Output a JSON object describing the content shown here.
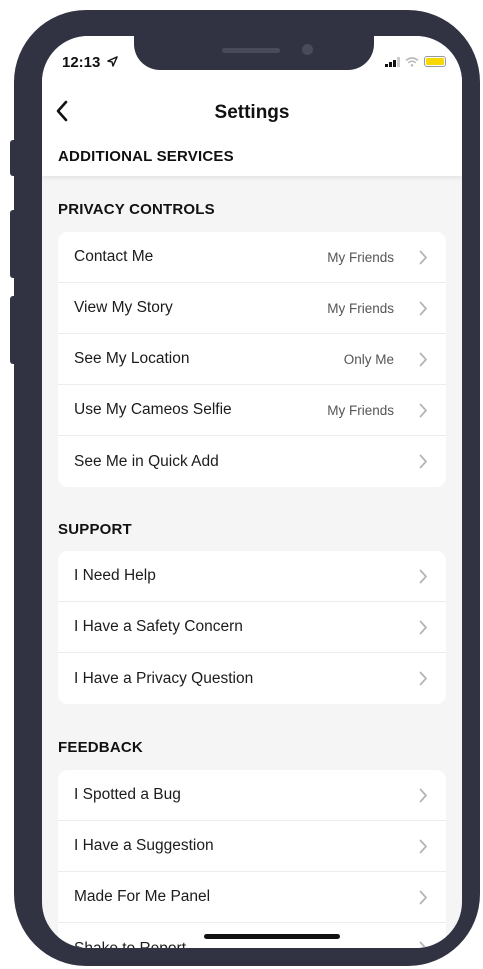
{
  "status": {
    "time": "12:13"
  },
  "nav": {
    "title": "Settings"
  },
  "additional_services": "ADDITIONAL SERVICES",
  "sections": {
    "privacy": {
      "title": "PRIVACY CONTROLS",
      "rows": [
        {
          "label": "Contact Me",
          "value": "My Friends"
        },
        {
          "label": "View My Story",
          "value": "My Friends"
        },
        {
          "label": "See My Location",
          "value": "Only Me"
        },
        {
          "label": "Use My Cameos Selfie",
          "value": "My Friends"
        },
        {
          "label": "See Me in Quick Add",
          "value": ""
        }
      ]
    },
    "support": {
      "title": "SUPPORT",
      "rows": [
        {
          "label": "I Need Help"
        },
        {
          "label": "I Have a Safety Concern"
        },
        {
          "label": "I Have a Privacy Question"
        }
      ]
    },
    "feedback": {
      "title": "FEEDBACK",
      "rows": [
        {
          "label": "I Spotted a Bug"
        },
        {
          "label": "I Have a Suggestion"
        },
        {
          "label": "Made For Me Panel"
        },
        {
          "label": "Shake to Report"
        }
      ]
    }
  },
  "colors": {
    "frame": "#323342",
    "background": "#f5f5f6",
    "card": "#ffffff",
    "battery": "#f7d800"
  },
  "icons": [
    "location-arrow-icon",
    "signal-icon",
    "wifi-icon",
    "battery-icon",
    "back-chevron-icon",
    "chevron-right-icon"
  ]
}
